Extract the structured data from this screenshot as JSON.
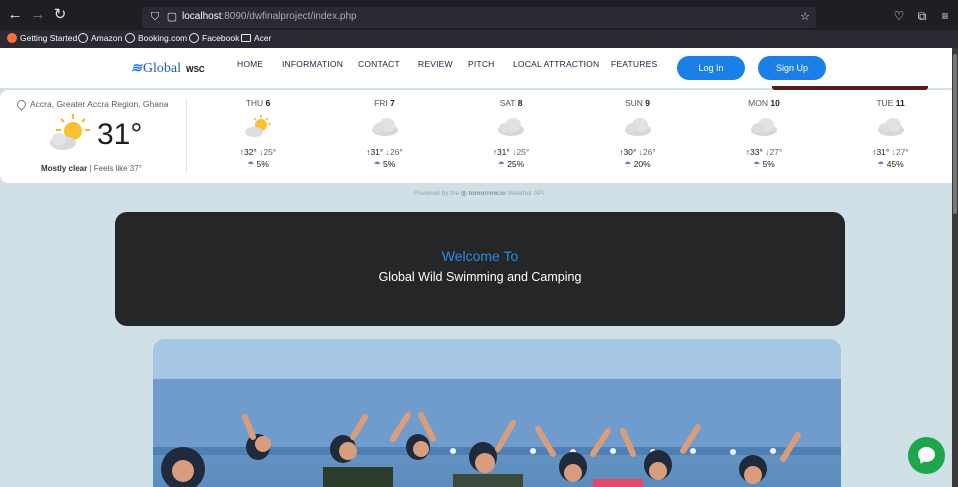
{
  "browser": {
    "url_host": "localhost",
    "url_rest": ":8090/dwfinalproject/index.php",
    "bookmarks": [
      "Getting Started",
      "Amazon",
      "Booking.com",
      "Facebook",
      "Acer"
    ]
  },
  "navbar": {
    "logo_text": "Global",
    "logo_sub": "WSC",
    "links": [
      "HOME",
      "INFORMATION",
      "CONTACT",
      "REVIEW",
      "PITCH",
      "LOCAL ATTRACTION",
      "FEATURES"
    ],
    "login_label": "Log In",
    "signup_label": "Sign Up"
  },
  "weather": {
    "location": "Accra, Greater Accra Region, Ghana",
    "current_temp": "31°",
    "condition": "Mostly clear",
    "feels_like": "Feels like 37°",
    "days": [
      {
        "name": "THU",
        "date": "6",
        "high": "32°",
        "low": "25°",
        "pop": "5%",
        "icon": "sun-cloud-icon"
      },
      {
        "name": "FRI",
        "date": "7",
        "high": "31°",
        "low": "26°",
        "pop": "5%",
        "icon": "cloud-icon"
      },
      {
        "name": "SAT",
        "date": "8",
        "high": "31°",
        "low": "25°",
        "pop": "25%",
        "icon": "cloud-icon"
      },
      {
        "name": "SUN",
        "date": "9",
        "high": "30°",
        "low": "26°",
        "pop": "20%",
        "icon": "cloud-icon"
      },
      {
        "name": "MON",
        "date": "10",
        "high": "33°",
        "low": "27°",
        "pop": "5%",
        "icon": "cloud-icon"
      },
      {
        "name": "TUE",
        "date": "11",
        "high": "31°",
        "low": "27°",
        "pop": "45%",
        "icon": "cloud-icon"
      }
    ],
    "powered_prefix": "Powered by the",
    "powered_brand": "tomorrow.io",
    "powered_suffix": "Weather API"
  },
  "welcome": {
    "title": "Welcome To",
    "subtitle": "Global Wild Swimming and Camping"
  },
  "colors": {
    "accent": "#1a7fe6",
    "banner_bg": "#252628",
    "page_bg": "#cfe0e6",
    "chat_green": "#1ea64a"
  }
}
